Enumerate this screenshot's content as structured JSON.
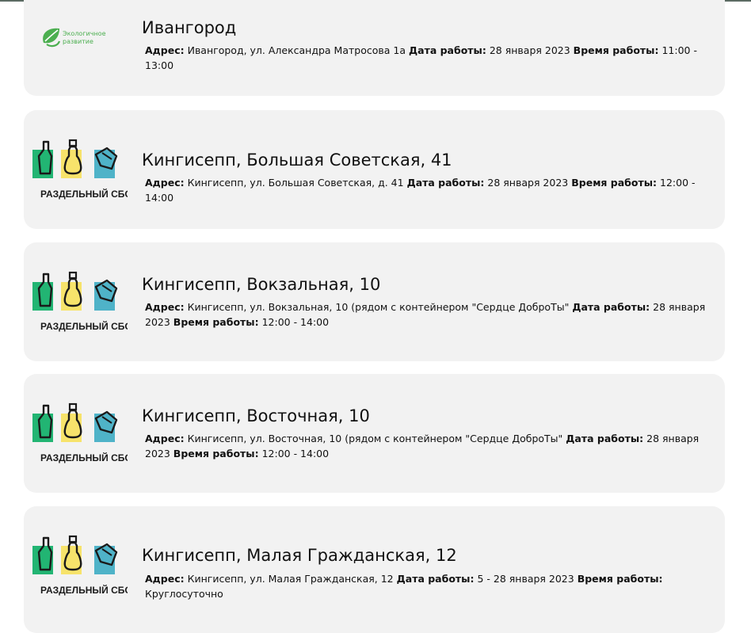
{
  "labels": {
    "address": "Адрес:",
    "date": "Дата работы:",
    "time": "Время работы:"
  },
  "logos": {
    "eco": {
      "icon": "leaf-icon",
      "line1": "Экологичное",
      "line2": "развитие",
      "color": "#4caf50"
    },
    "sep": {
      "text": "РАЗДЕЛЬНЫЙ СБОР",
      "green": "#22b573",
      "yellow": "#f7e36b",
      "blue": "#4fb3c8"
    }
  },
  "points": [
    {
      "title": "Ивангород",
      "address": "Ивангород, ул. Александра Матросова 1а",
      "date": "28 января 2023",
      "time": "11:00 - 13:00"
    },
    {
      "title": "Кингисепп, Большая Советская, 41",
      "address": "Кингисепп, ул. Большая Советская, д. 41",
      "date": "28 января 2023",
      "time": "12:00 - 14:00"
    },
    {
      "title": "Кингисепп, Вокзальная, 10",
      "address": "Кингисепп, ул. Вокзальная, 10 (рядом с контейнером \"Сердце ДоброТы\"",
      "date": "28 января 2023",
      "time": "12:00 - 14:00"
    },
    {
      "title": "Кингисепп, Восточная, 10",
      "address": "Кингисепп, ул. Восточная, 10 (рядом с контейнером \"Сердце ДоброТы\"",
      "date": "28 января 2023",
      "time": "12:00 - 14:00"
    },
    {
      "title": "Кингисепп, Малая Гражданская, 12",
      "address": "Кингисепп, ул. Малая Гражданская, 12",
      "date": "5 - 28 января 2023",
      "time": "Круглосуточно"
    }
  ]
}
